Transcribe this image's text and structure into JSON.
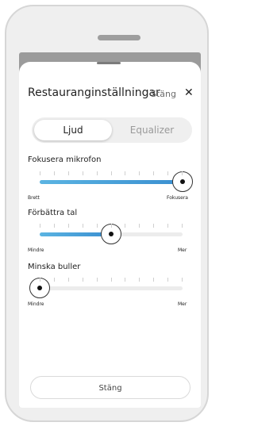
{
  "sheet": {
    "title": "Restauranginställningar",
    "close_label": "Stäng",
    "close_icon_glyph": "✕"
  },
  "tabs": [
    {
      "label": "Ljud",
      "active": true
    },
    {
      "label": "Equalizer",
      "active": false
    }
  ],
  "sliders": [
    {
      "label": "Fokusera mikrofon",
      "min_label": "Brett",
      "max_label": "Fokusera",
      "value": 1.0
    },
    {
      "label": "Förbättra tal",
      "min_label": "Mindre",
      "max_label": "Mer",
      "value": 0.5
    },
    {
      "label": "Minska buller",
      "min_label": "Mindre",
      "max_label": "Mer",
      "value": 0.0
    }
  ],
  "footer": {
    "close_button_label": "Stäng"
  },
  "colors": {
    "accent": "#3a8fd0"
  }
}
